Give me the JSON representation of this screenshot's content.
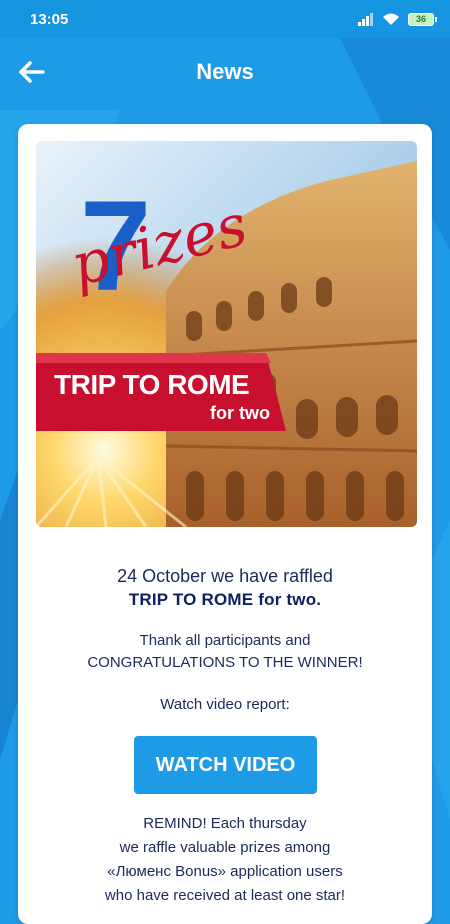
{
  "status_bar": {
    "time": "13:05",
    "battery": "36"
  },
  "header": {
    "title": "News"
  },
  "image": {
    "seven": "7",
    "prizes": "prizes",
    "banner_line1": "TRIP TO ROME",
    "banner_line2": "for two"
  },
  "article": {
    "date_line": "24 October we have raffled",
    "headline": "TRIP TO ROME for two.",
    "thanks_line1": "Thank all participants and",
    "thanks_line2": "CONGRATULATIONS TO THE WINNER!",
    "watch_label": "Watch video report:",
    "watch_button": "WATCH VIDEO",
    "remind_line1": "REMIND! Each thursday",
    "remind_line2": "we raffle valuable prizes among",
    "remind_line3": "«Люменс Bonus» application users",
    "remind_line4": "who have received at least one star!"
  },
  "colors": {
    "primary_blue": "#1e9be6",
    "banner_red": "#c8102e",
    "text_navy": "#1b2a5b"
  }
}
